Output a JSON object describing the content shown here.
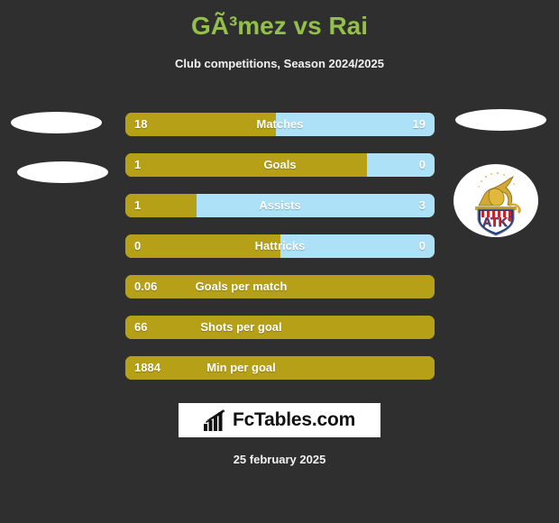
{
  "header": {
    "title": "GÃ³mez vs Rai",
    "subtitle": "Club competitions, Season 2024/2025"
  },
  "colors": {
    "background": "#2f2f2f",
    "title": "#93c04a",
    "player_left": "#b5a018",
    "player_right": "#ade1f7",
    "text": "#ffffff"
  },
  "chart_data": {
    "type": "bar",
    "title": "GÃ³mez vs Rai",
    "subtitle": "Club competitions, Season 2024/2025",
    "xlabel": "",
    "ylabel": "",
    "legend_position": "none",
    "grid": false,
    "series": [
      {
        "name": "GÃ³mez",
        "color": "#b5a018",
        "side": "left"
      },
      {
        "name": "Rai",
        "color": "#ade1f7",
        "side": "right"
      }
    ],
    "categories": [
      "Matches",
      "Goals",
      "Assists",
      "Hattricks",
      "Goals per match",
      "Shots per goal",
      "Min per goal"
    ],
    "rows": [
      {
        "label": "Matches",
        "left_value": "18",
        "right_value": "19",
        "left_pct": 48.6,
        "two_sided": true
      },
      {
        "label": "Goals",
        "left_value": "1",
        "right_value": "0",
        "left_pct": 78.0,
        "two_sided": true
      },
      {
        "label": "Assists",
        "left_value": "1",
        "right_value": "3",
        "left_pct": 23.0,
        "two_sided": true
      },
      {
        "label": "Hattricks",
        "left_value": "0",
        "right_value": "0",
        "left_pct": 50.0,
        "two_sided": true
      },
      {
        "label": "Goals per match",
        "left_value": "0.06",
        "right_value": "",
        "left_pct": 100.0,
        "two_sided": false
      },
      {
        "label": "Shots per goal",
        "left_value": "66",
        "right_value": "",
        "left_pct": 100.0,
        "two_sided": false
      },
      {
        "label": "Min per goal",
        "left_value": "1884",
        "right_value": "",
        "left_pct": 100.0,
        "two_sided": false
      }
    ]
  },
  "badges": {
    "left_placeholder_1": "player-photo-placeholder",
    "left_placeholder_2": "player-photo-placeholder",
    "right_placeholder_1": "player-photo-placeholder",
    "right_club_logo": "atk-club-crest",
    "club_logo_text": "ATK"
  },
  "footer": {
    "logo_icon": "bar-chart-arrow-icon",
    "logo_text": "FcTables.com",
    "date": "25 february 2025"
  }
}
